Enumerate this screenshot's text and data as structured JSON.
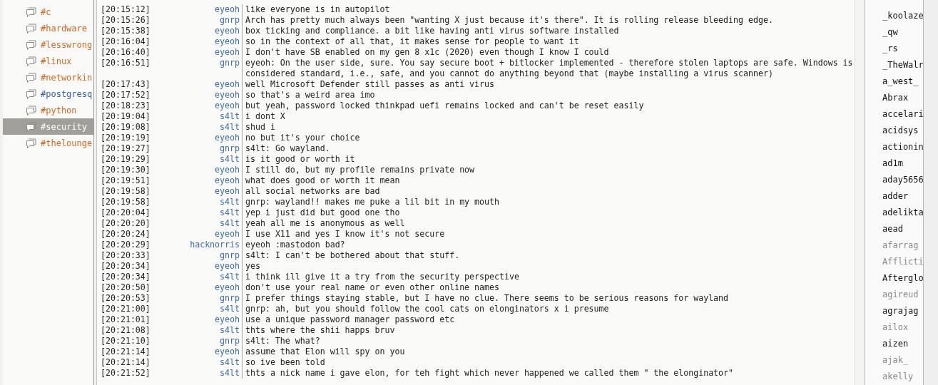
{
  "channels": [
    {
      "name": "#c",
      "color": "#d2691e",
      "selected": false
    },
    {
      "name": "#hardware",
      "color": "#d2691e",
      "selected": false
    },
    {
      "name": "#lesswrong",
      "color": "#d2691e",
      "selected": false
    },
    {
      "name": "#linux",
      "color": "#d2691e",
      "selected": false
    },
    {
      "name": "#networkin",
      "color": "#d2691e",
      "selected": false
    },
    {
      "name": "#postgresq",
      "color": "#3a5fb0",
      "selected": false
    },
    {
      "name": "#python",
      "color": "#d2691e",
      "selected": false
    },
    {
      "name": "#security",
      "color": "#ffffff",
      "selected": true
    },
    {
      "name": "#thelounge",
      "color": "#d2691e",
      "selected": false
    }
  ],
  "messages": [
    {
      "time": "[20:15:12]",
      "nick": "eyeoh",
      "text": "like everyone is in autopilot"
    },
    {
      "time": "[20:15:26]",
      "nick": "gnrp",
      "text": "Arch has pretty much always been \"wanting X just because it's there\". It is rolling release bleeding edge."
    },
    {
      "time": "[20:15:38]",
      "nick": "eyeoh",
      "text": "box ticking and compliance. a bit like having anti virus software installed"
    },
    {
      "time": "[20:16:04]",
      "nick": "eyeoh",
      "text": "so in the context of all that, it makes sense for people to want it"
    },
    {
      "time": "[20:16:40]",
      "nick": "eyeoh",
      "text": "I don't have SB enabled on my gen 8 x1c (2020) even though I know I could"
    },
    {
      "time": "[20:16:51]",
      "nick": "gnrp",
      "text": "eyeoh: On the user side, sure. You say secure boot + bitlocker implemented - therefore stolen laptops are safe. Windows is considered standard, i.e., safe, and you cannot do anything beyond that (maybe installing a virus scanner)"
    },
    {
      "time": "[20:17:43]",
      "nick": "eyeoh",
      "text": "well Microsoft Defender still passes as anti virus"
    },
    {
      "time": "[20:17:52]",
      "nick": "eyeoh",
      "text": "so that's a weird area imo"
    },
    {
      "time": "[20:18:23]",
      "nick": "eyeoh",
      "text": "but yeah, password locked thinkpad uefi remains locked and can't be reset easily"
    },
    {
      "time": "[20:19:04]",
      "nick": "s4lt",
      "text": "i dont X"
    },
    {
      "time": "[20:19:08]",
      "nick": "s4lt",
      "text": "shud i"
    },
    {
      "time": "[20:19:19]",
      "nick": "eyeoh",
      "text": "no but it's your choice"
    },
    {
      "time": "[20:19:27]",
      "nick": "gnrp",
      "text": "s4lt: Go wayland."
    },
    {
      "time": "[20:19:29]",
      "nick": "s4lt",
      "text": "is it good or worth it"
    },
    {
      "time": "[20:19:30]",
      "nick": "eyeoh",
      "text": "I still do, but my profile remains private now"
    },
    {
      "time": "[20:19:51]",
      "nick": "eyeoh",
      "text": "what does good or worth it mean"
    },
    {
      "time": "[20:19:58]",
      "nick": "eyeoh",
      "text": "all social networks are bad"
    },
    {
      "time": "[20:19:58]",
      "nick": "s4lt",
      "text": "gnrp: wayland!! makes me puke a lil bit in my mouth"
    },
    {
      "time": "[20:20:04]",
      "nick": "s4lt",
      "text": "yep i just did but good one tho"
    },
    {
      "time": "[20:20:20]",
      "nick": "s4lt",
      "text": "yeah all me is anonymous as well"
    },
    {
      "time": "[20:20:24]",
      "nick": "eyeoh",
      "text": "I use X11 and yes I know it's not secure"
    },
    {
      "time": "[20:20:29]",
      "nick": "hacknorris",
      "text": "eyeoh :mastodon bad?"
    },
    {
      "time": "[20:20:33]",
      "nick": "gnrp",
      "text": "s4lt: I can't be bothered about that stuff."
    },
    {
      "time": "[20:20:34]",
      "nick": "eyeoh",
      "text": "yes"
    },
    {
      "time": "[20:20:34]",
      "nick": "s4lt",
      "text": "i think ill give it a try from the security perspective"
    },
    {
      "time": "[20:20:50]",
      "nick": "eyeoh",
      "text": "don't use your real name or even other online names"
    },
    {
      "time": "[20:20:53]",
      "nick": "gnrp",
      "text": "I prefer things staying stable, but I have no clue. There seems to be serious reasons for wayland"
    },
    {
      "time": "[20:21:00]",
      "nick": "s4lt",
      "text": "gnrp: ah, but you should follow the cool cats on elonginators x i presume"
    },
    {
      "time": "[20:21:01]",
      "nick": "eyeoh",
      "text": "use a unique password manager password etc"
    },
    {
      "time": "[20:21:08]",
      "nick": "s4lt",
      "text": "thts where the shii happs bruv"
    },
    {
      "time": "[20:21:10]",
      "nick": "gnrp",
      "text": "s4lt: The what?"
    },
    {
      "time": "[20:21:14]",
      "nick": "eyeoh",
      "text": "assume that Elon will spy on you"
    },
    {
      "time": "[20:21:14]",
      "nick": "s4lt",
      "text": "so ive been told"
    },
    {
      "time": "[20:21:52]",
      "nick": "s4lt",
      "text": "thts a nick name i gave elon, for teh fight which never happened we called them \" the elonginator\""
    }
  ],
  "users": [
    {
      "name": "_koolaze",
      "away": false
    },
    {
      "name": "_qw",
      "away": false
    },
    {
      "name": "_rs",
      "away": false
    },
    {
      "name": "_TheWalr",
      "away": false
    },
    {
      "name": "a_west_",
      "away": false
    },
    {
      "name": "Abrax",
      "away": false
    },
    {
      "name": "accelari",
      "away": false
    },
    {
      "name": "acidsys",
      "away": false
    },
    {
      "name": "actionin",
      "away": false
    },
    {
      "name": "ad1m",
      "away": false
    },
    {
      "name": "aday5656",
      "away": false
    },
    {
      "name": "adder",
      "away": false
    },
    {
      "name": "adelikta",
      "away": false
    },
    {
      "name": "aead",
      "away": false
    },
    {
      "name": "afarrag",
      "away": true
    },
    {
      "name": "Afflicti",
      "away": true
    },
    {
      "name": "Afterglo",
      "away": false
    },
    {
      "name": "agireud",
      "away": true
    },
    {
      "name": "agrajag",
      "away": false
    },
    {
      "name": "ailox",
      "away": true
    },
    {
      "name": "aizen",
      "away": false
    },
    {
      "name": "ajak_",
      "away": true
    },
    {
      "name": "akelly",
      "away": true
    }
  ]
}
